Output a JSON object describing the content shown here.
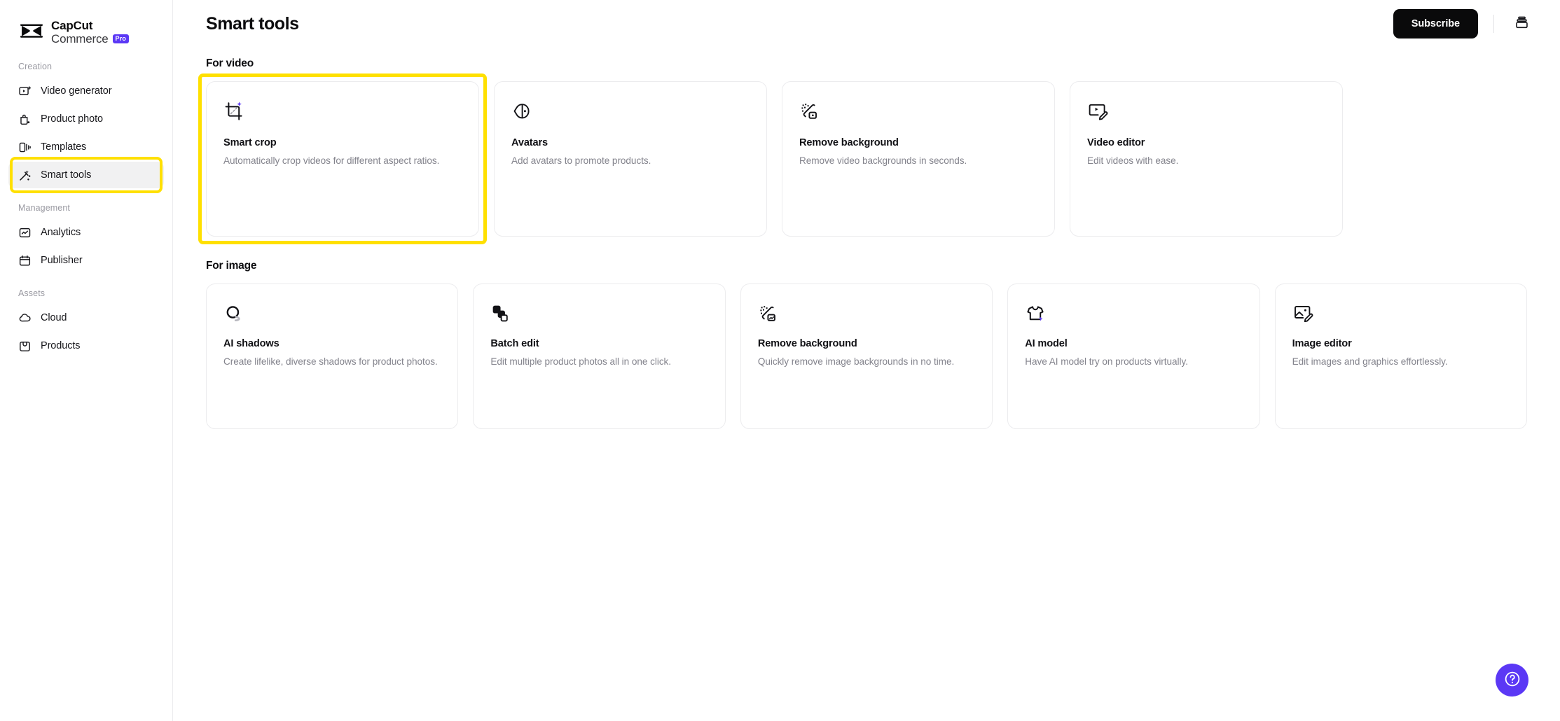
{
  "brand": {
    "line1": "CapCut",
    "line2": "Commerce",
    "badge": "Pro",
    "logo_icon": "capcut-logo-icon"
  },
  "sidebar": {
    "sections": [
      {
        "label": "Creation",
        "items": [
          {
            "label": "Video generator",
            "icon": "video-generator-icon",
            "active": false
          },
          {
            "label": "Product photo",
            "icon": "product-photo-icon",
            "active": false
          },
          {
            "label": "Templates",
            "icon": "templates-icon",
            "active": false
          },
          {
            "label": "Smart tools",
            "icon": "smart-tools-icon",
            "active": true
          }
        ]
      },
      {
        "label": "Management",
        "items": [
          {
            "label": "Analytics",
            "icon": "analytics-icon",
            "active": false
          },
          {
            "label": "Publisher",
            "icon": "publisher-icon",
            "active": false
          }
        ]
      },
      {
        "label": "Assets",
        "items": [
          {
            "label": "Cloud",
            "icon": "cloud-icon",
            "active": false
          },
          {
            "label": "Products",
            "icon": "products-icon",
            "active": false
          }
        ]
      }
    ]
  },
  "header": {
    "title": "Smart tools",
    "subscribe_label": "Subscribe",
    "archive_icon": "archive-stack-icon"
  },
  "sections": [
    {
      "title": "For video",
      "cards": [
        {
          "title": "Smart crop",
          "desc": "Automatically crop videos for different aspect ratios.",
          "icon": "smart-crop-icon",
          "highlighted": true
        },
        {
          "title": "Avatars",
          "desc": "Add avatars to promote products.",
          "icon": "avatar-face-icon",
          "highlighted": false
        },
        {
          "title": "Remove background",
          "desc": "Remove video backgrounds in seconds.",
          "icon": "remove-background-icon",
          "highlighted": false
        },
        {
          "title": "Video editor",
          "desc": "Edit videos with ease.",
          "icon": "video-editor-icon",
          "highlighted": false
        }
      ]
    },
    {
      "title": "For image",
      "cards": [
        {
          "title": "AI shadows",
          "desc": "Create lifelike, diverse shadows for product photos.",
          "icon": "ai-shadows-icon",
          "highlighted": false
        },
        {
          "title": "Batch edit",
          "desc": "Edit multiple product photos all in one click.",
          "icon": "batch-edit-icon",
          "highlighted": false
        },
        {
          "title": "Remove background",
          "desc": "Quickly remove image backgrounds in no time.",
          "icon": "remove-background-icon",
          "highlighted": false
        },
        {
          "title": "AI model",
          "desc": "Have AI model try on products virtually.",
          "icon": "ai-model-shirt-icon",
          "highlighted": false
        },
        {
          "title": "Image editor",
          "desc": "Edit images and graphics effortlessly.",
          "icon": "image-editor-icon",
          "highlighted": false
        }
      ]
    }
  ],
  "help": {
    "icon": "help-question-icon"
  },
  "colors": {
    "accent_purple": "#5b38f5",
    "highlight_yellow": "#ffe000",
    "subscribe_bg": "#0a0a0b",
    "text_primary": "#111115",
    "text_muted": "#83838c"
  }
}
